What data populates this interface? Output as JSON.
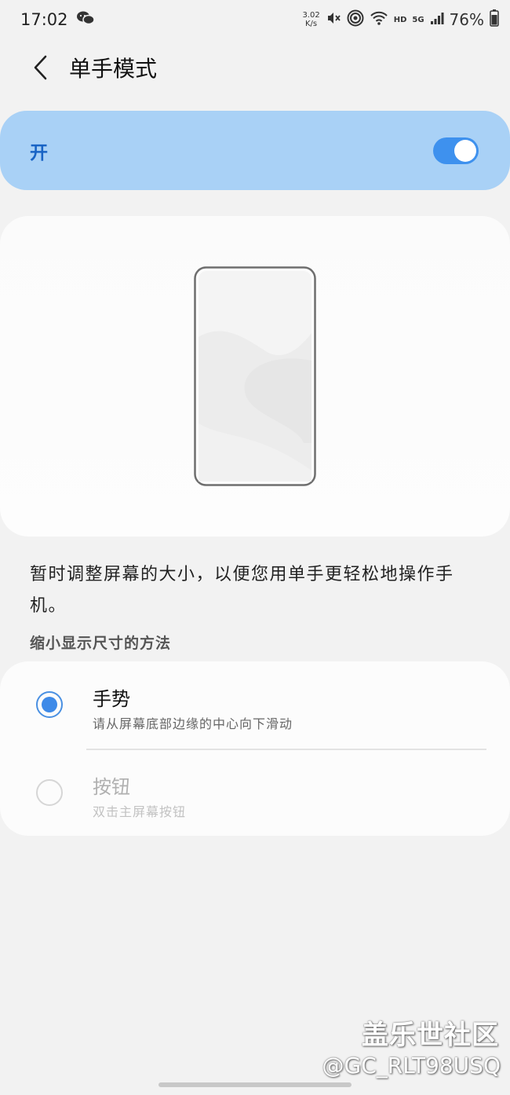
{
  "status_bar": {
    "time": "17:02",
    "net_speed_value": "3.02",
    "net_speed_unit": "K/s",
    "hd_label": "HD",
    "network_label": "5G",
    "battery_percent": "76%"
  },
  "header": {
    "title": "单手模式"
  },
  "master_switch": {
    "label": "开",
    "state": "on",
    "accent_color": "#3e91ee",
    "background_color": "#a9d1f6"
  },
  "description": "暂时调整屏幕的大小，以便您用单手更轻松地操作手机。",
  "method_section": {
    "header": "缩小显示尺寸的方法",
    "options": [
      {
        "title": "手势",
        "subtitle": "请从屏幕底部边缘的中心向下滑动",
        "selected": true,
        "enabled": true
      },
      {
        "title": "按钮",
        "subtitle": "双击主屏幕按钮",
        "selected": false,
        "enabled": false
      }
    ]
  },
  "watermark": {
    "site": "盖乐世社区",
    "user": "@GC_RLT98USQ"
  }
}
